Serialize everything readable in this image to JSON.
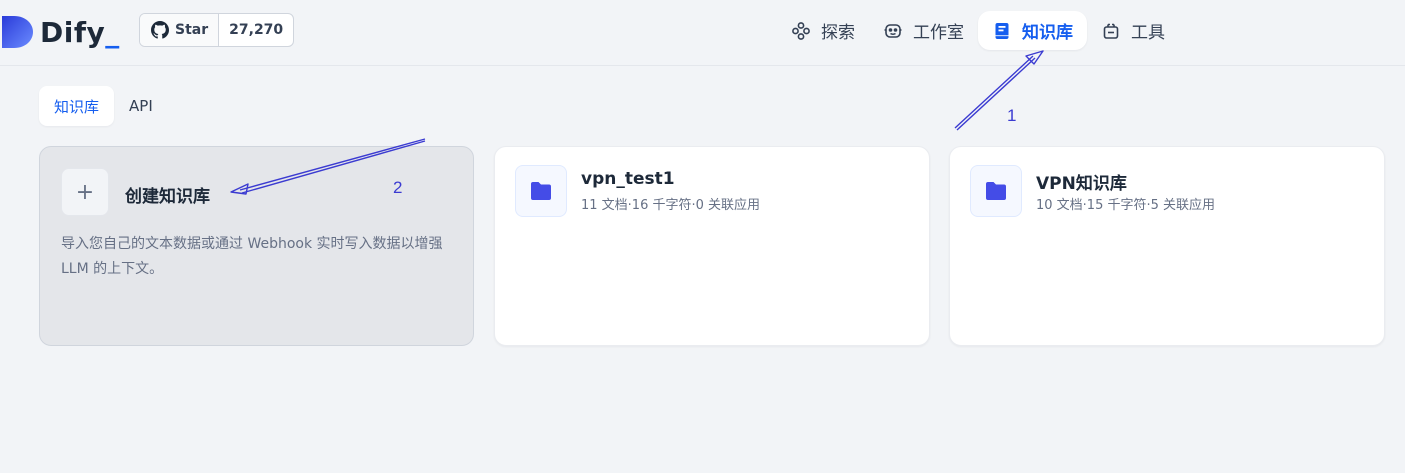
{
  "header": {
    "logo_text": "Dify",
    "logo_underscore": "_",
    "github": {
      "star_label": "Star",
      "count": "27,270"
    },
    "nav": [
      {
        "label": "探索",
        "icon": "explore-icon"
      },
      {
        "label": "工作室",
        "icon": "robot-icon"
      },
      {
        "label": "知识库",
        "icon": "book-icon",
        "active": true
      },
      {
        "label": "工具",
        "icon": "tool-icon"
      }
    ]
  },
  "tabs": [
    {
      "label": "知识库",
      "active": true
    },
    {
      "label": "API"
    }
  ],
  "create_card": {
    "plus": "+",
    "title": "创建知识库",
    "description": "导入您自己的文本数据或通过 Webhook 实时写入数据以增强 LLM 的上下文。"
  },
  "datasets": [
    {
      "name": "vpn_test1",
      "meta": "11 文档·16 千字符·0 关联应用"
    },
    {
      "name": "VPN知识库",
      "meta": "10 文档·15 千字符·5 关联应用"
    }
  ],
  "annotations": {
    "label_1": "1",
    "label_2": "2"
  },
  "colors": {
    "accent": "#155eef",
    "annotation": "#3b3bd1",
    "folder": "#444ce7"
  }
}
